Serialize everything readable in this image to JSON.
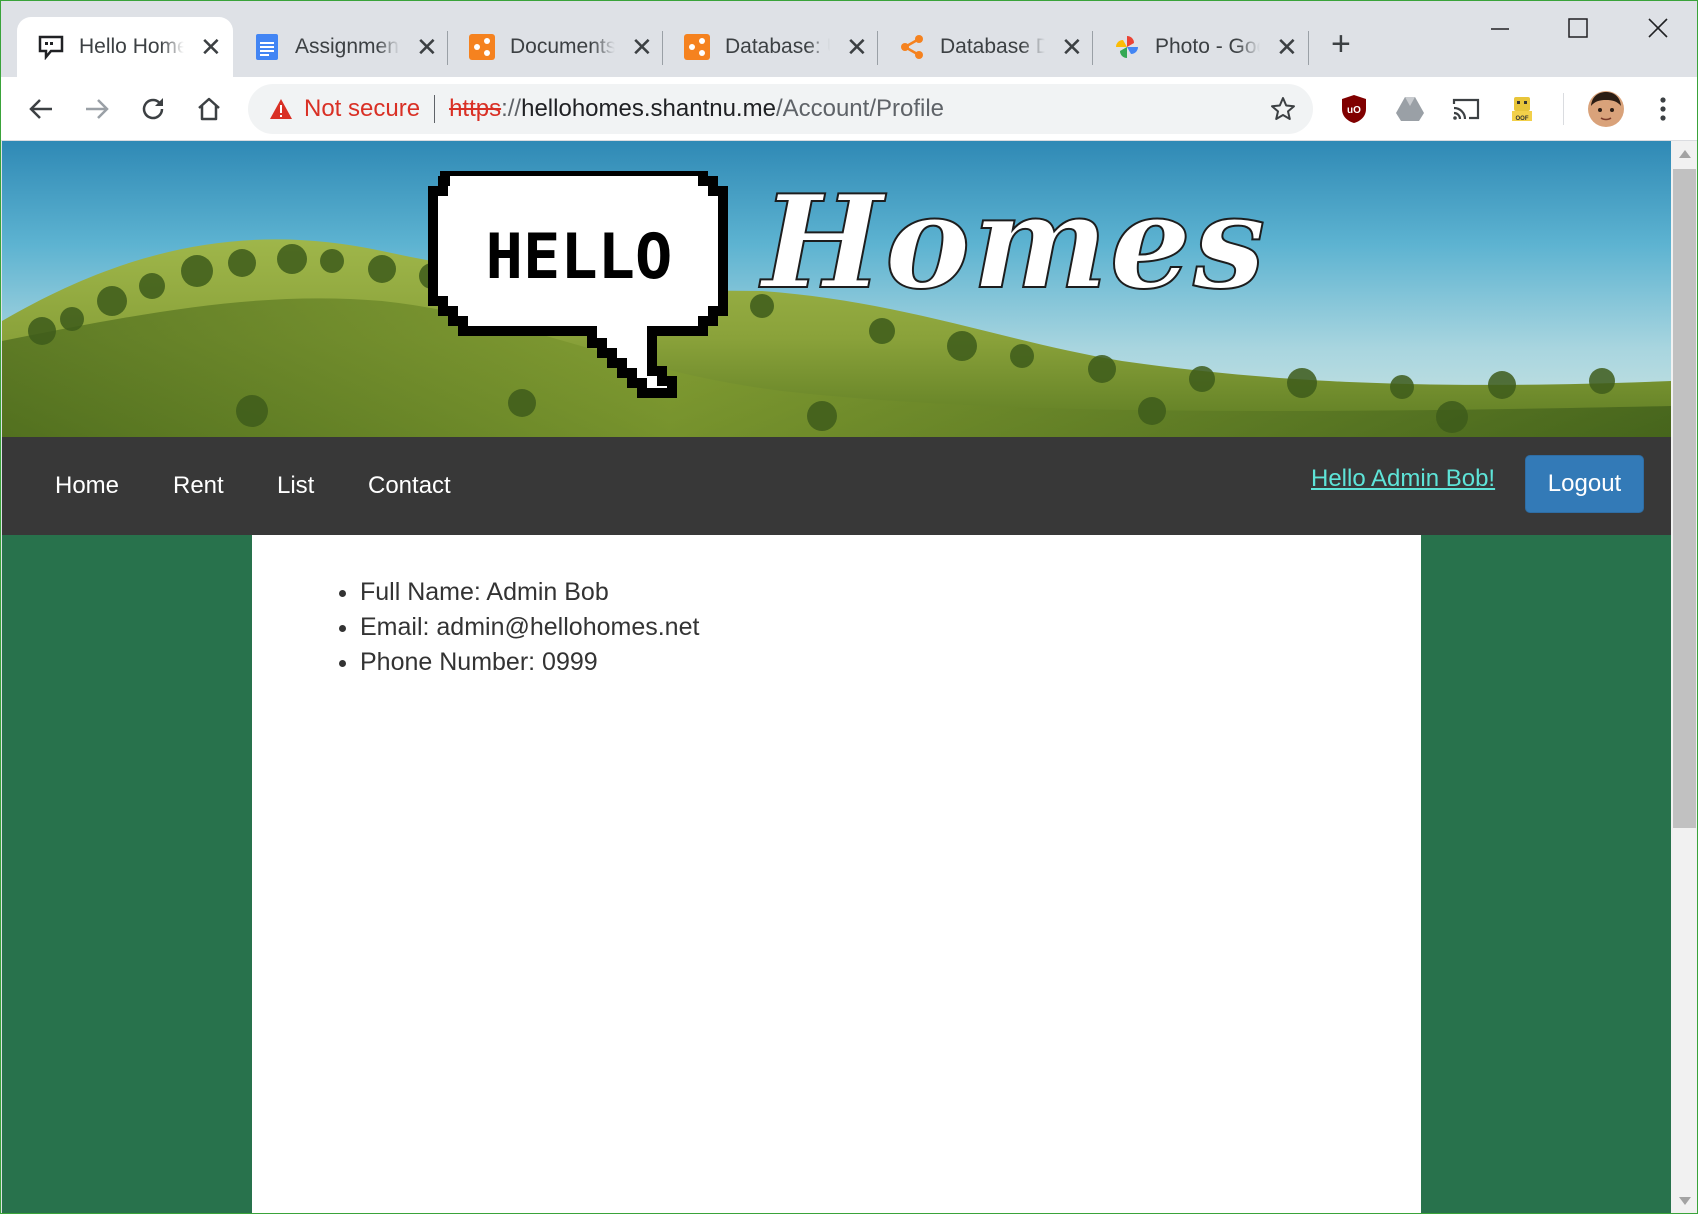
{
  "browser": {
    "tabs": [
      {
        "title": "Hello Homes",
        "icon": "chat-bubble-icon",
        "active": true
      },
      {
        "title": "Assignment",
        "icon": "google-docs-icon",
        "active": false
      },
      {
        "title": "Documents",
        "icon": "orange-diagram-icon",
        "active": false
      },
      {
        "title": "Database: U",
        "icon": "orange-diagram-icon",
        "active": false
      },
      {
        "title": "Database D",
        "icon": "share-icon",
        "active": false
      },
      {
        "title": "Photo - Google",
        "icon": "pinwheel-icon",
        "active": false
      }
    ],
    "omnibox": {
      "security_label": "Not secure",
      "url_scheme": "https",
      "url_sep": "://",
      "url_host": "hellohomes.shantnu.me",
      "url_path": "/Account/Profile"
    }
  },
  "site": {
    "logo_bubble_text": "HELLO",
    "logo_script_text": "Homes",
    "nav": {
      "links": [
        "Home",
        "Rent",
        "List",
        "Contact"
      ],
      "greeting": "Hello Admin Bob!",
      "logout_label": "Logout"
    },
    "profile": {
      "items": [
        "Full Name: Admin Bob",
        "Email: admin@hellohomes.net",
        "Phone Number: 0999"
      ]
    }
  },
  "colors": {
    "page_background": "#28724c",
    "navbar": "#383838",
    "greeting_link": "#5ee4d8",
    "logout_button": "#337ab7",
    "not_secure": "#d93025"
  }
}
